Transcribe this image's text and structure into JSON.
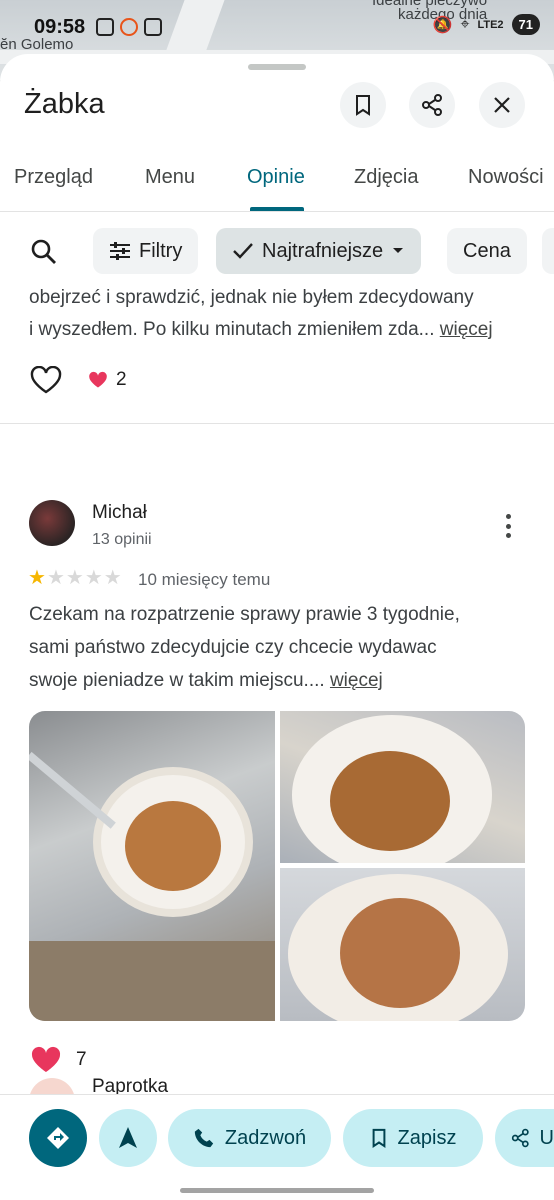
{
  "status_bar": {
    "time": "09:58",
    "battery": "71",
    "network": "LTE2",
    "map_label_left": "ĕn Golemo",
    "map_label_top": "Idealne pieczywo",
    "map_label_right": "każdego dnia"
  },
  "header": {
    "title": "Żabka",
    "save_icon": "bookmark-icon",
    "share_icon": "share-icon",
    "close_icon": "close-icon"
  },
  "tabs": [
    {
      "label": "Przegląd"
    },
    {
      "label": "Menu"
    },
    {
      "label": "Opinie"
    },
    {
      "label": "Zdjęcia"
    },
    {
      "label": "Nowości"
    }
  ],
  "active_tab": "Opinie",
  "filters": {
    "search_icon": "search-icon",
    "filter_label": "Filtry",
    "sort_label": "Najtrafniejsze",
    "price_label": "Cena"
  },
  "previous_review": {
    "text_line1": "obejrzeć i sprawdzić, jednak nie byłem zdecydowany",
    "text_line2": "i wyszedłem. Po kilku minutach zmieniłem zda...",
    "more": "więcej",
    "likes": "2"
  },
  "review": {
    "author": "Michał",
    "meta": "13 opinii",
    "rating": 1,
    "rating_max": 5,
    "when": "10 miesięcy temu",
    "text_line1": "Czekam na rozpatrzenie sprawy prawie 3 tygodnie,",
    "text_line2": "sami państwo zdecydujcie czy chcecie wydawac",
    "text_line3": "swoje pieniadze w takim miejscu....",
    "more": "więcej",
    "likes": "7"
  },
  "next_review": {
    "author": "Paprotka"
  },
  "actions": {
    "call": "Zadzwoń",
    "save": "Zapisz",
    "share_partial": "U"
  },
  "colors": {
    "accent": "#00677d",
    "star": "#f6b600",
    "heart": "#e8365d",
    "fab_bg": "#c5eef3"
  }
}
